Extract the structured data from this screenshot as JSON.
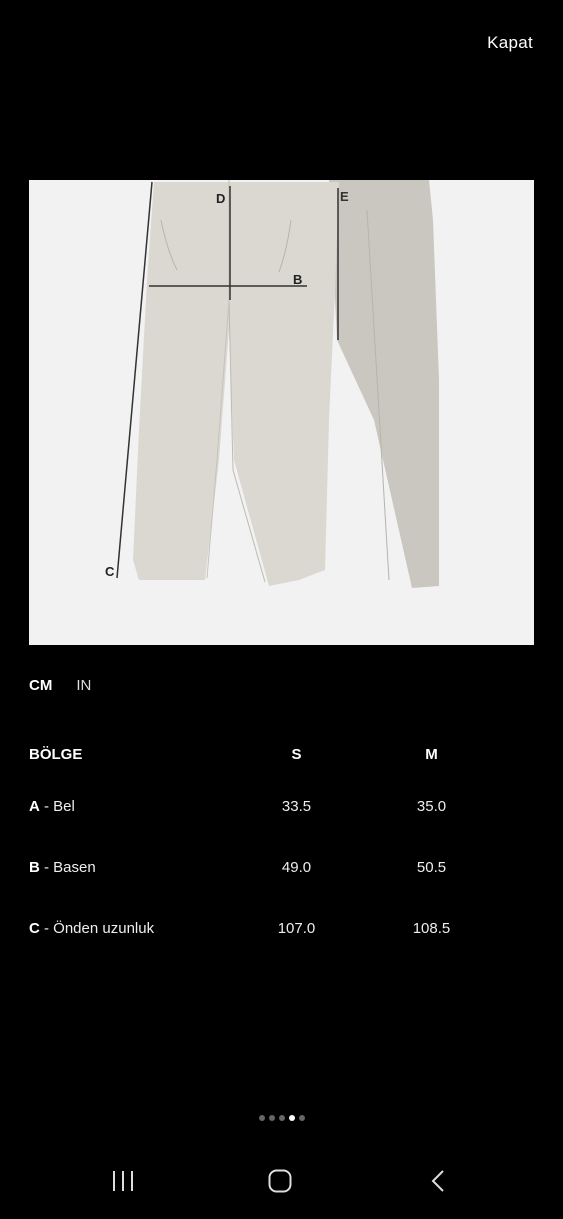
{
  "header": {
    "close_label": "Kapat"
  },
  "diagram": {
    "labels": {
      "d": "D",
      "b": "B",
      "e": "E",
      "c": "C"
    }
  },
  "units": {
    "active": "CM",
    "inactive": "IN"
  },
  "table": {
    "headers": {
      "region": "BÖLGE",
      "s": "S",
      "m": "M"
    },
    "rows": [
      {
        "code": "A",
        "name": " - Bel",
        "s": "33.5",
        "m": "35.0"
      },
      {
        "code": "B",
        "name": " - Basen",
        "s": "49.0",
        "m": "50.5"
      },
      {
        "code": "C",
        "name": " - Önden uzunluk",
        "s": "107.0",
        "m": "108.5"
      }
    ]
  },
  "pager": {
    "count": 5,
    "active_index": 3
  },
  "navbar": {
    "icons": [
      "recent-apps-icon",
      "home-icon",
      "back-icon"
    ]
  }
}
